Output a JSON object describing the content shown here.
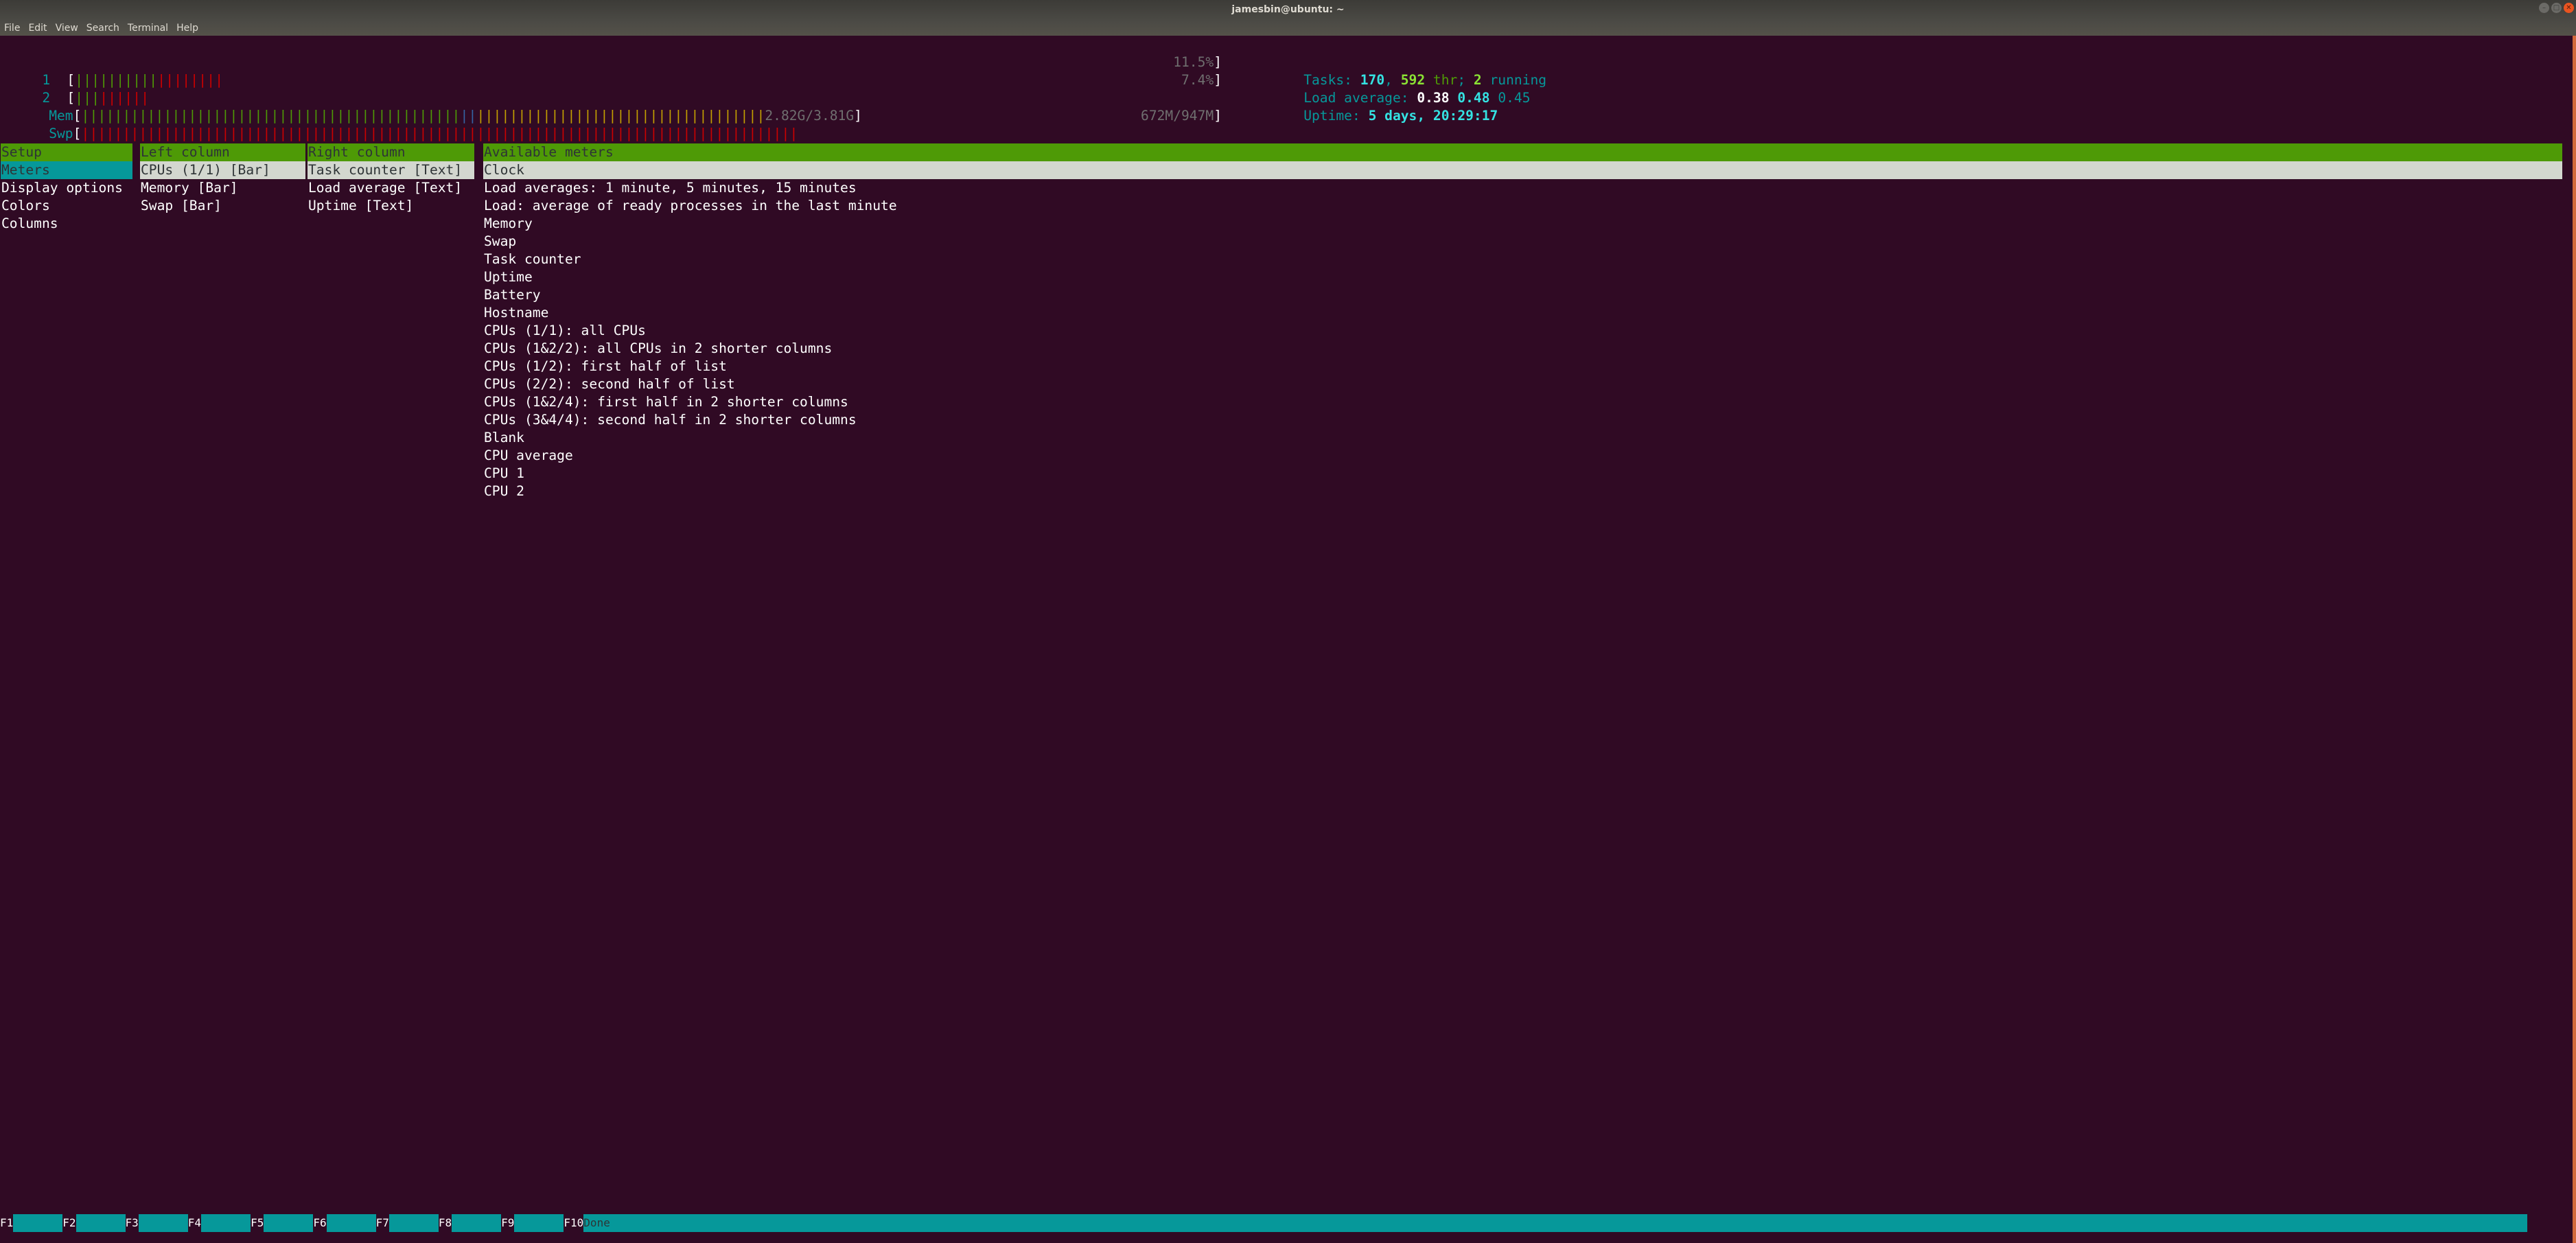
{
  "window": {
    "title": "jamesbin@ubuntu: ~",
    "controls": [
      "minimize-icon",
      "maximize-icon",
      "close-icon"
    ],
    "menu": [
      "File",
      "Edit",
      "View",
      "Search",
      "Terminal",
      "Help"
    ]
  },
  "meters": {
    "cpu1": {
      "label": "1",
      "value": "11.5%",
      "bars_normal": 10,
      "bars_kernel": 8
    },
    "cpu2": {
      "label": "2",
      "value": "7.4%",
      "bars_normal": 3,
      "bars_kernel": 6
    },
    "mem": {
      "label": "Mem",
      "value": "2.82G/3.81G",
      "bars_used": 46,
      "bars_buffers": 2,
      "bars_cache": 35
    },
    "swp": {
      "label": "Swp",
      "value": "672M/947M",
      "bars_used": 87
    },
    "tasks": {
      "label": "Tasks: ",
      "count": "170",
      "sep1": ", ",
      "threads": "592",
      "thr_label": " thr",
      "sep2": "; ",
      "running": "2",
      "running_label": " running"
    },
    "load": {
      "label": "Load average: ",
      "one": "0.38",
      "five": "0.48",
      "fifteen": "0.45"
    },
    "uptime": {
      "label": "Uptime: ",
      "value": "5 days, 20:29:17"
    }
  },
  "setup": {
    "header": "Setup",
    "items": [
      "Meters",
      "Display options",
      "Colors",
      "Columns"
    ],
    "selected": "Meters"
  },
  "left_column": {
    "header": "Left column",
    "items": [
      "CPUs (1/1) [Bar]",
      "Memory [Bar]",
      "Swap [Bar]"
    ]
  },
  "right_column": {
    "header": "Right column",
    "items": [
      "Task counter [Text]",
      "Load average [Text]",
      "Uptime [Text]"
    ]
  },
  "available_meters": {
    "header": "Available meters",
    "items": [
      "Clock",
      "Load averages: 1 minute, 5 minutes, 15 minutes",
      "Load: average of ready processes in the last minute",
      "Memory",
      "Swap",
      "Task counter",
      "Uptime",
      "Battery",
      "Hostname",
      "CPUs (1/1): all CPUs",
      "CPUs (1&2/2): all CPUs in 2 shorter columns",
      "CPUs (1/2): first half of list",
      "CPUs (2/2): second half of list",
      "CPUs (1&2/4): first half in 2 shorter columns",
      "CPUs (3&4/4): second half in 2 shorter columns",
      "Blank",
      "CPU average",
      "CPU 1",
      "CPU 2"
    ]
  },
  "function_bar": [
    {
      "key": "F1",
      "label": ""
    },
    {
      "key": "F2",
      "label": ""
    },
    {
      "key": "F3",
      "label": ""
    },
    {
      "key": "F4",
      "label": ""
    },
    {
      "key": "F5",
      "label": ""
    },
    {
      "key": "F6",
      "label": ""
    },
    {
      "key": "F7",
      "label": ""
    },
    {
      "key": "F8",
      "label": ""
    },
    {
      "key": "F9",
      "label": ""
    },
    {
      "key": "F10",
      "label": "Done"
    }
  ],
  "colors": {
    "terminal_bg": "#300a24",
    "header_green": "#4e9a06",
    "selection_cyan": "#06989a",
    "selection_gray": "#d3d7cf",
    "scrollbar": "#d2693c"
  }
}
